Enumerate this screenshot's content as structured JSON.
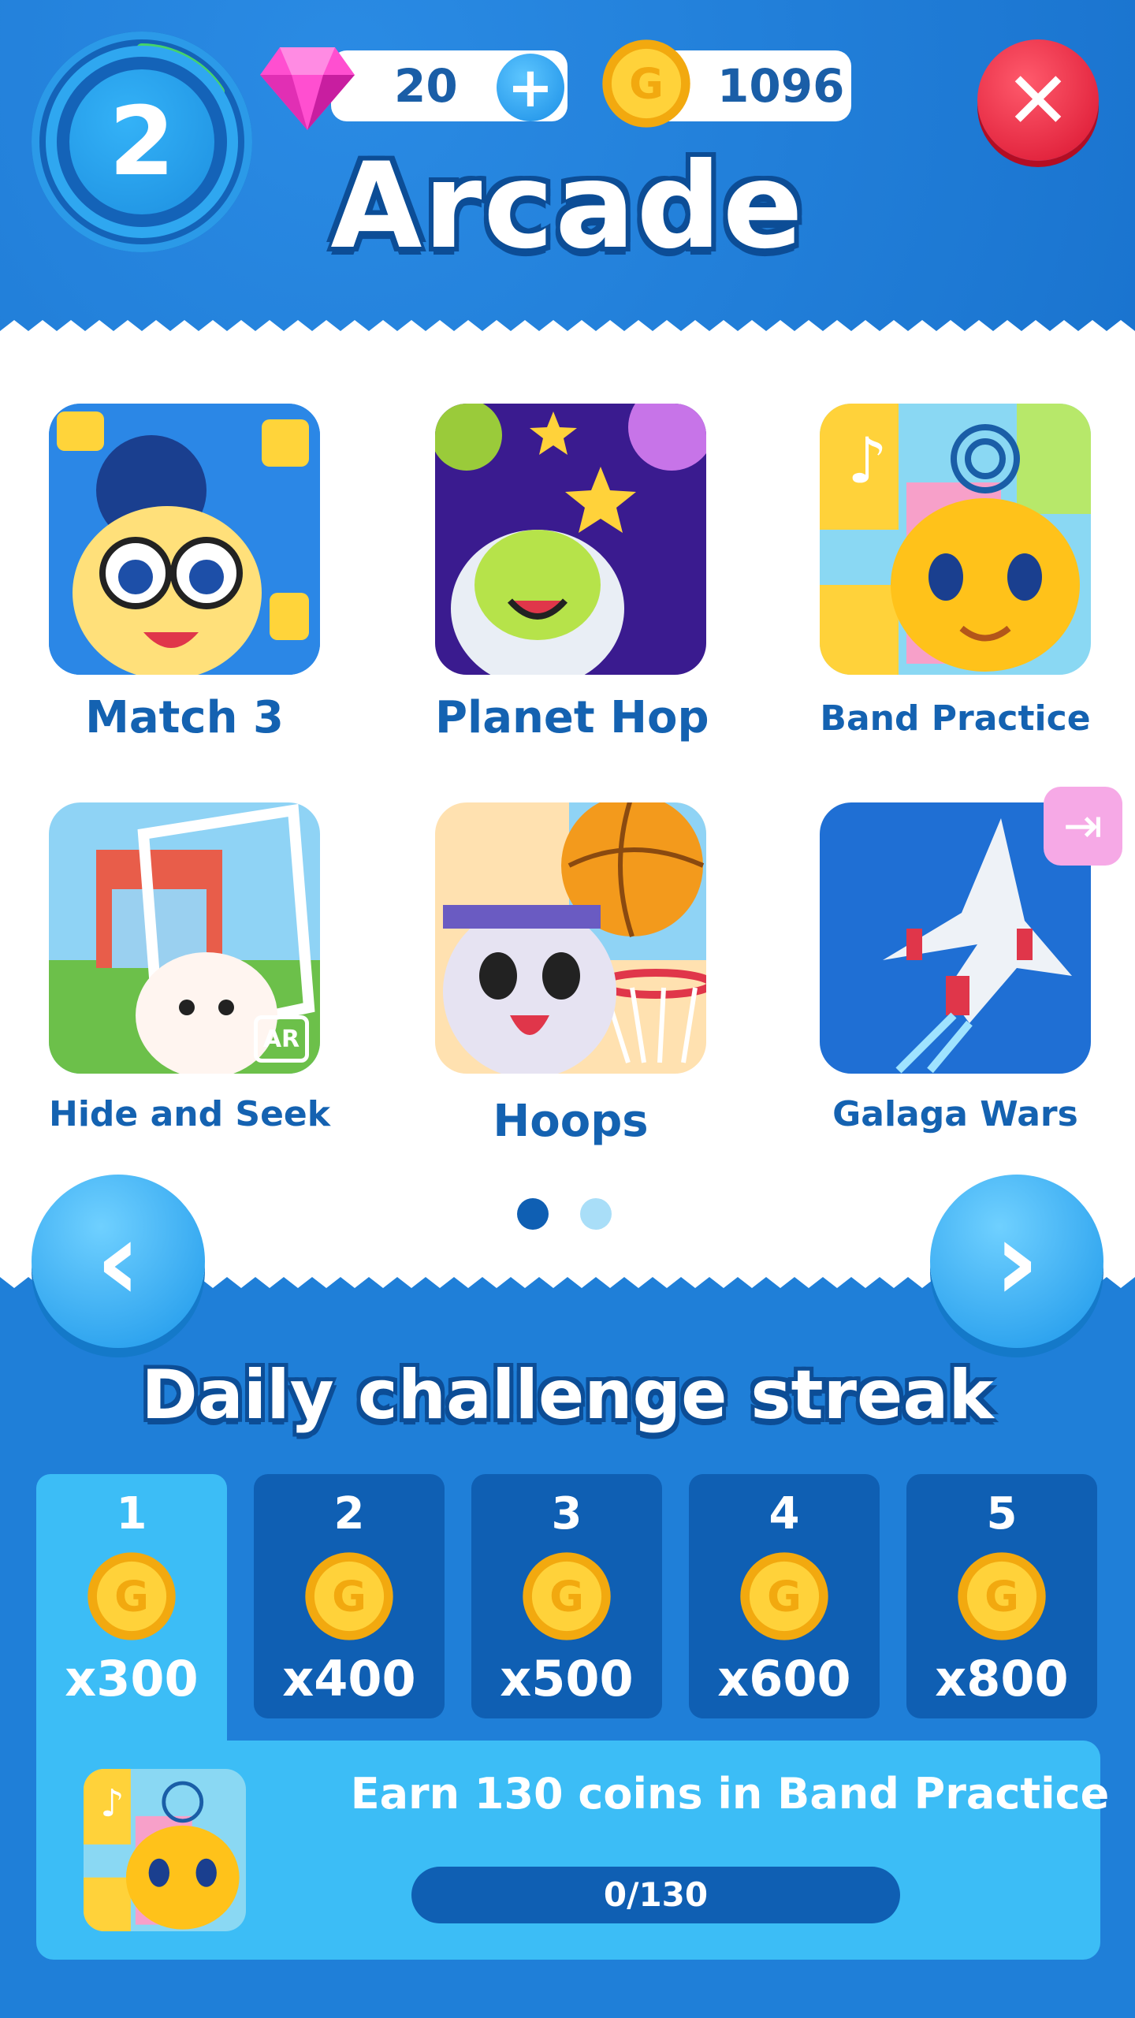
{
  "header": {
    "level": "2",
    "gems": "20",
    "coins": "1096",
    "title": "Arcade"
  },
  "games": [
    {
      "label": "Match 3"
    },
    {
      "label": "Planet Hop"
    },
    {
      "label": "Band Practice"
    },
    {
      "label": "Hide and Seek"
    },
    {
      "label": "Hoops"
    },
    {
      "label": "Galaga Wars"
    }
  ],
  "pagination": {
    "current_page": 1,
    "total_pages": 2
  },
  "ar_badge": "AR",
  "daily": {
    "title": "Daily challenge streak",
    "days": [
      {
        "num": "1",
        "amount": "x300"
      },
      {
        "num": "2",
        "amount": "x400"
      },
      {
        "num": "3",
        "amount": "x500"
      },
      {
        "num": "4",
        "amount": "x600"
      },
      {
        "num": "5",
        "amount": "x800"
      }
    ],
    "challenge": {
      "text": "Earn 130 coins in Band Practice",
      "progress_text": "0/130",
      "progress_value": 0
    }
  },
  "colors": {
    "accent_blue": "#1f7fd8",
    "dark_blue": "#0f5fb3",
    "light_blue": "#3cbdf6",
    "label_blue": "#1462b1",
    "close_red": "#e21d37",
    "gold": "#f6b91a"
  },
  "icons": [
    "gem-icon",
    "plus-icon",
    "coin-icon",
    "close-icon",
    "chevron-left-icon",
    "chevron-right-icon",
    "share-icon"
  ]
}
